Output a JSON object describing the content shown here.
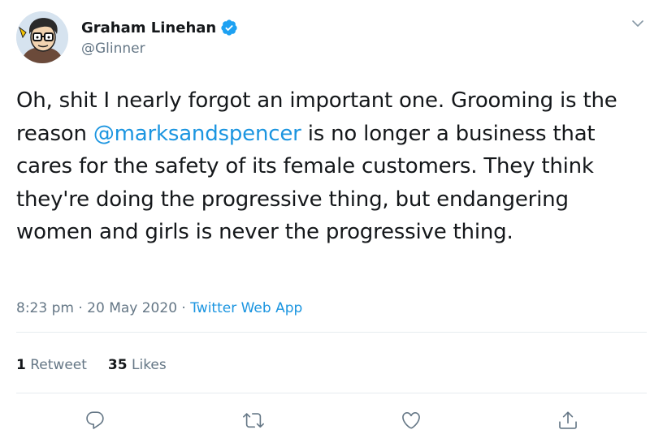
{
  "author": {
    "display_name": "Graham Linehan",
    "handle": "@Glinner",
    "avatar_icon": "cartoon-avatar",
    "verified_icon": "verified-badge-icon",
    "verified_color": "#1da1f2"
  },
  "tweet": {
    "text_before": "Oh, shit I nearly forgot an important one. Grooming is the reason ",
    "mention": "@marksandspencer",
    "text_after": " is no longer a business that cares for the safety of its female customers. They think they're doing the progressive thing, but endangering women and girls is never the progressive thing.",
    "time": "8:23 pm",
    "separator": " · ",
    "date": "20 May 2020",
    "source": "Twitter Web App"
  },
  "stats": {
    "retweets_count": "1",
    "retweets_label": "Retweet",
    "likes_count": "35",
    "likes_label": "Likes"
  },
  "actions": [
    {
      "icon": "reply-icon"
    },
    {
      "icon": "retweet-icon"
    },
    {
      "icon": "like-icon"
    },
    {
      "icon": "share-icon"
    }
  ],
  "colors": {
    "link": "#1b95e0",
    "secondary_text": "#657786",
    "divider": "#e6ecf0"
  }
}
